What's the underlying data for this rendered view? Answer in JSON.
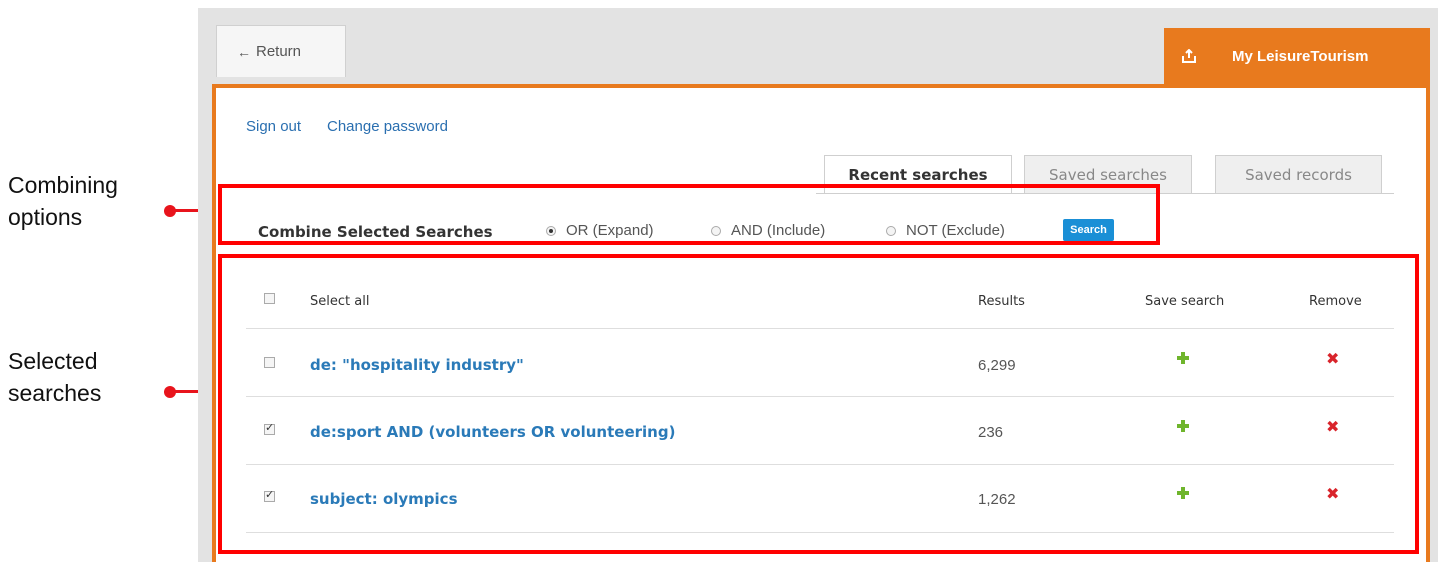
{
  "annotations": {
    "combining": [
      "Combining",
      "options"
    ],
    "selected": [
      "Selected",
      "searches"
    ]
  },
  "nav": {
    "return_label": "Return",
    "account_tab_label": "My LeisureTourism"
  },
  "account_links": {
    "sign_out": "Sign out",
    "change_password": "Change password"
  },
  "tabs": [
    {
      "label": "Recent searches",
      "active": true
    },
    {
      "label": "Saved searches",
      "active": false
    },
    {
      "label": "Saved records",
      "active": false
    }
  ],
  "combine": {
    "label": "Combine Selected Searches",
    "options": [
      {
        "label": "OR (Expand)",
        "checked": true
      },
      {
        "label": "AND (Include)",
        "checked": false
      },
      {
        "label": "NOT (Exclude)",
        "checked": false
      }
    ],
    "button_label": "Search"
  },
  "table": {
    "headers": {
      "select_all": "Select all",
      "results": "Results",
      "save_search": "Save search",
      "remove": "Remove"
    },
    "rows": [
      {
        "query": "de: \"hospitality industry\"",
        "results": "6,299",
        "checked": false
      },
      {
        "query": "de:sport AND (volunteers OR volunteering)",
        "results": "236",
        "checked": true
      },
      {
        "query": "subject: olympics",
        "results": "1,262",
        "checked": true
      }
    ]
  },
  "colors": {
    "accent_orange": "#e87a1e",
    "link_blue": "#2a7ab8",
    "annotation_red": "#ff0000",
    "add_green": "#6fb52c",
    "remove_red": "#d9242b"
  }
}
